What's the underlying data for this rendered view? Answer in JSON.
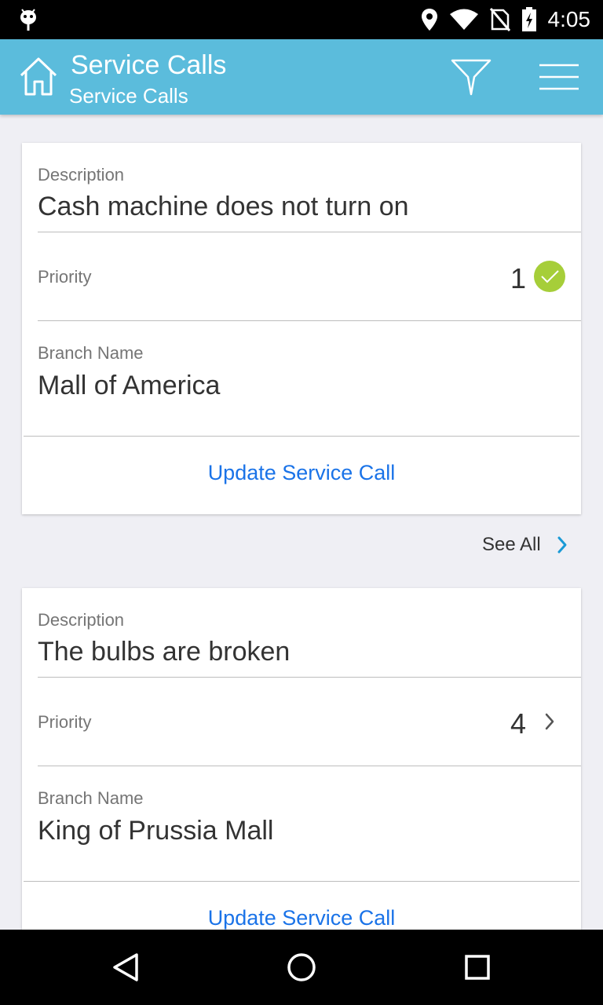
{
  "status_bar": {
    "time": "4:05",
    "icons": [
      "android-debug-icon",
      "location-icon",
      "wifi-icon",
      "no-sim-icon",
      "battery-charging-icon"
    ]
  },
  "app_bar": {
    "title": "Service Calls",
    "subtitle": "Service Calls",
    "icons": [
      "home-icon",
      "filter-icon",
      "menu-icon"
    ]
  },
  "cards": [
    {
      "description_label": "Description",
      "description_value": "Cash machine does not turn on",
      "priority_label": "Priority",
      "priority_value": "1",
      "priority_icon": "check-circle-icon",
      "branch_label": "Branch Name",
      "branch_value": "Mall of America",
      "action_label": "Update Service Call"
    },
    {
      "description_label": "Description",
      "description_value": "The bulbs are broken",
      "priority_label": "Priority",
      "priority_value": "4",
      "priority_icon": "chevron-right-icon",
      "branch_label": "Branch Name",
      "branch_value": "King of Prussia Mall",
      "action_label": "Update Service Call"
    }
  ],
  "see_all": {
    "label": "See All"
  },
  "colors": {
    "app_bar": "#5bbcdc",
    "accent_link": "#1a73e8",
    "check_green": "#a6ce39",
    "background": "#efeff4"
  },
  "nav_bar": {
    "icons": [
      "back-icon",
      "home-circle-icon",
      "recents-icon"
    ]
  }
}
